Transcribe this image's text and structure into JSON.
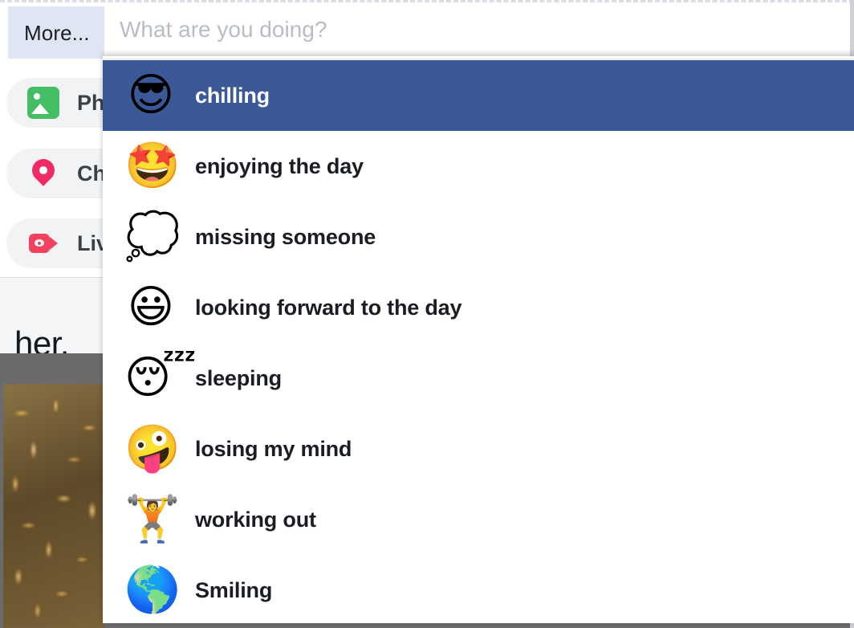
{
  "composer": {
    "more_button_label": "More...",
    "body_text_fragment": "her.",
    "actions": [
      {
        "label": "Photo",
        "icon": "photo-icon",
        "color": "#45bd62"
      },
      {
        "label": "Check in",
        "icon": "location-pin-icon",
        "color": "#f02a63"
      },
      {
        "label": "Live video",
        "icon": "live-video-icon",
        "color": "#f3425f"
      }
    ],
    "attachment_alt": "bees-photo-thumbnail"
  },
  "search": {
    "placeholder": "What are you doing?",
    "value": ""
  },
  "dropdown": {
    "selected_index": 0,
    "highlight_color": "#3b5998",
    "items": [
      {
        "emoji": "😎",
        "icon": "sunglasses-face-emoji",
        "label": "chilling"
      },
      {
        "emoji": "🤩",
        "icon": "star-struck-emoji",
        "label": "enjoying the day"
      },
      {
        "emoji": "💭",
        "icon": "thought-balloon-emoji",
        "label": "missing someone"
      },
      {
        "emoji": "😃",
        "icon": "grinning-big-eyes-emoji",
        "label": "looking forward to the day"
      },
      {
        "emoji": "😴",
        "icon": "sleeping-face-emoji",
        "label": "sleeping"
      },
      {
        "emoji": "🤪",
        "icon": "zany-face-emoji",
        "label": "losing my mind"
      },
      {
        "emoji": "🏋",
        "icon": "dumbbell-emoji",
        "label": "working out"
      },
      {
        "emoji": "🌎",
        "icon": "smiling-globe-emoji",
        "label": "Smiling"
      }
    ]
  }
}
